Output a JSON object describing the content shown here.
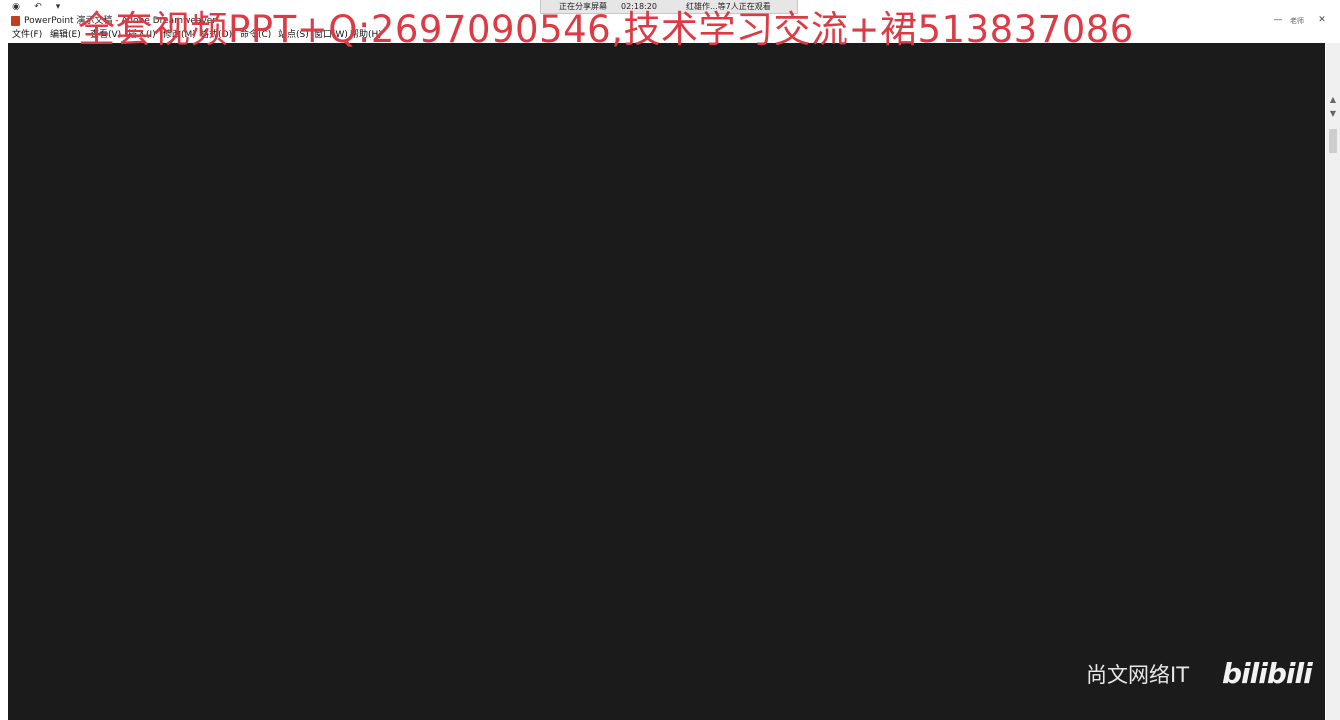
{
  "share_bar": {
    "status": "正在分享屏幕",
    "elapsed": "02:18:20",
    "viewers": "红雄作...等7人正在观看"
  },
  "quick_access": {
    "icons": [
      "app-menu-icon",
      "undo-icon",
      "customize-icon"
    ]
  },
  "window": {
    "title": "PowerPoint 演示文稿 - Adobe Dreamweaver",
    "controls": [
      "minimize-icon",
      "close-icon"
    ],
    "right_tags": [
      "老师"
    ]
  },
  "menu": {
    "items": [
      "文件(F)",
      "编辑(E)",
      "查看(V)",
      "插入(I)",
      "修改(M)",
      "格式(O)",
      "命令(C)",
      "站点(S)",
      "窗口(W)",
      "帮助(H)"
    ]
  },
  "overlay_text": "全套视频PPT+Q:2697090546,技术学习交流+裙513837086",
  "watermark": {
    "channel": "尚文网络IT",
    "platform": "bilibili"
  },
  "colors": {
    "stage": "#1b1b1c",
    "overlay_red": "#dc3b45"
  }
}
